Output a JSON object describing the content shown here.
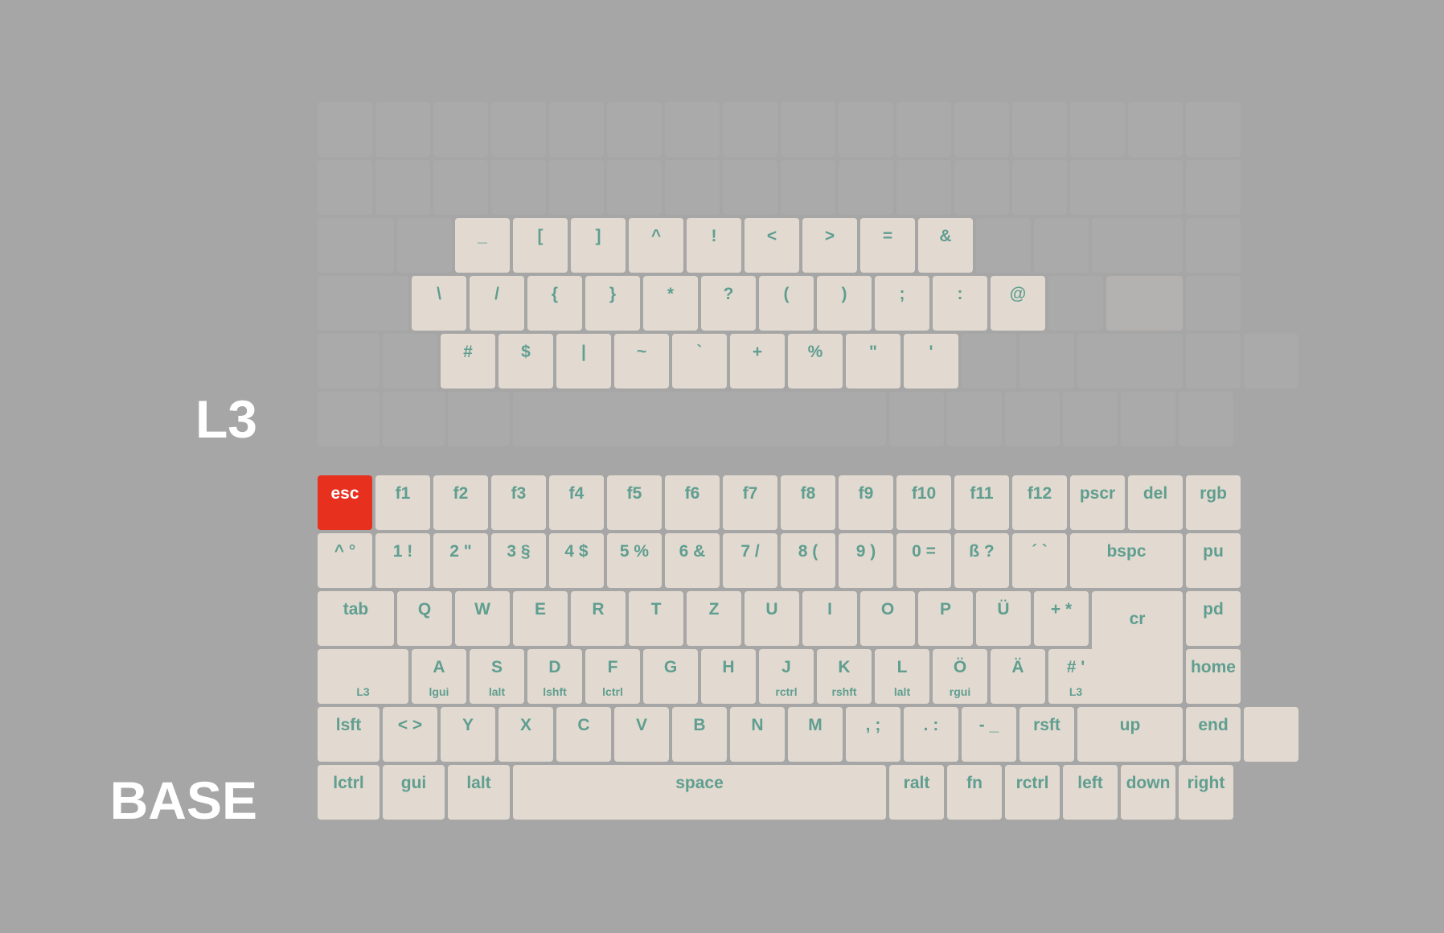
{
  "layers": {
    "l3": {
      "name": "L3"
    },
    "base": {
      "name": "BASE"
    }
  },
  "colors": {
    "background": "#a6a6a6",
    "key_active": "#e2dad0",
    "key_inactive": "#aaaaaa",
    "legend": "#5f9e90",
    "esc": "#e8301e",
    "label": "#ffffff"
  },
  "l3_keys": {
    "r3": [
      "_",
      "[",
      "]",
      "^",
      "!",
      "<",
      ">",
      "=",
      "&"
    ],
    "r4": [
      "\\",
      "/",
      "{",
      "}",
      "*",
      "?",
      "(",
      ")",
      ";",
      ":",
      "@"
    ],
    "r5": [
      "#",
      "$",
      "|",
      "~",
      "`",
      "+",
      "%",
      "\"",
      "'"
    ]
  },
  "base_keys": {
    "r1": [
      "esc",
      "f1",
      "f2",
      "f3",
      "f4",
      "f5",
      "f6",
      "f7",
      "f8",
      "f9",
      "f10",
      "f11",
      "f12",
      "pscr",
      "del",
      "rgb"
    ],
    "r2": [
      "^ °",
      "1 !",
      "2 \"",
      "3 §",
      "4 $",
      "5 %",
      "6 &",
      "7 /",
      "8 (",
      "9 )",
      "0 =",
      "ß ?",
      "´ `",
      "bspc",
      "pu"
    ],
    "r3": [
      "tab",
      "Q",
      "W",
      "E",
      "R",
      "T",
      "Z",
      "U",
      "I",
      "O",
      "P",
      "Ü",
      "+ *",
      "cr",
      "pd"
    ],
    "r4": [
      "A",
      "S",
      "D",
      "F",
      "G",
      "H",
      "J",
      "K",
      "L",
      "Ö",
      "Ä",
      "# '",
      "home"
    ],
    "r4_sub": [
      "L3",
      "lgui",
      "lalt",
      "lshft",
      "lctrl",
      "rctrl",
      "rshft",
      "lalt",
      "rgui",
      "L3"
    ],
    "r5": [
      "lsft",
      "< >",
      "Y",
      "X",
      "C",
      "V",
      "B",
      "N",
      "M",
      ", ;",
      ". :",
      "- _",
      "rsft",
      "up",
      "end"
    ],
    "r6": [
      "lctrl",
      "gui",
      "lalt",
      "space",
      "ralt",
      "fn",
      "rctrl",
      "left",
      "down",
      "right"
    ]
  }
}
